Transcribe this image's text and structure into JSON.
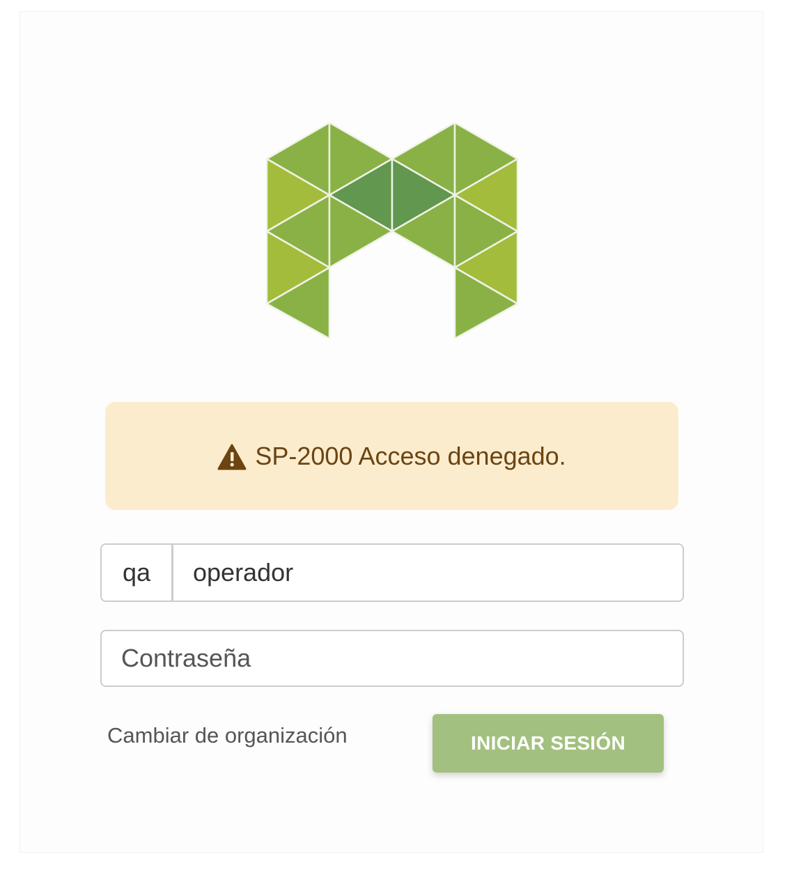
{
  "colors": {
    "brand_green_dark": "#61974f",
    "brand_green_mid": "#89b044",
    "brand_green_light": "#a3bc3a",
    "alert_bg": "#fcecce",
    "alert_text": "#6b4411",
    "button_bg": "#a2c07f"
  },
  "logo": {
    "icon": "triangle-m-logo"
  },
  "alert": {
    "icon": "warning-triangle-icon",
    "message": "SP-2000 Acceso denegado."
  },
  "login": {
    "org_prefix": "qa",
    "username_value": "operador",
    "password_placeholder": "Contraseña",
    "change_org_link": "Cambiar de organización",
    "submit_label": "INICIAR SESIÓN"
  }
}
